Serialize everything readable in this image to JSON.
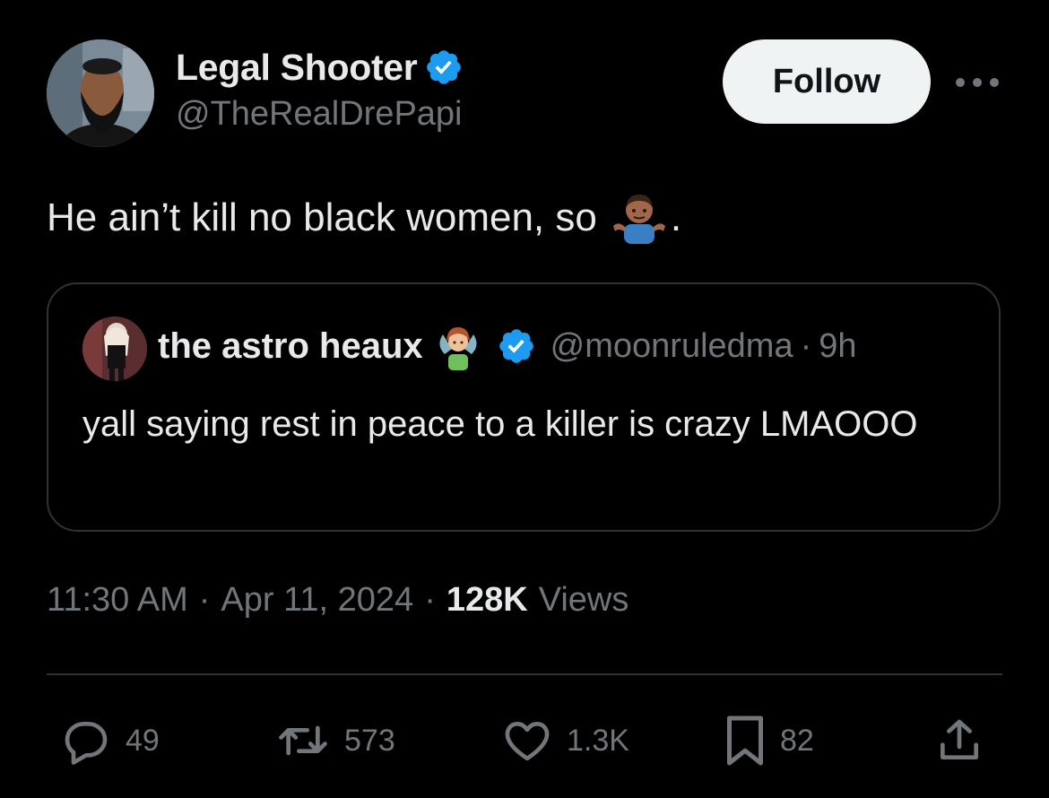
{
  "author": {
    "display_name": "Legal Shooter",
    "handle": "@TheRealDrePapi",
    "verified": true
  },
  "follow_button": {
    "label": "Follow"
  },
  "tweet": {
    "text": "He ain’t kill no black women, so",
    "emoji": "person-shrugging-emoji",
    "text_suffix": "."
  },
  "quoted_tweet": {
    "display_name": "the astro heaux",
    "name_emoji": "fairy-emoji",
    "verified": true,
    "handle": "@moonruledma",
    "separator": "·",
    "time": "9h",
    "text": "yall saying rest in peace to a killer is crazy LMAOOO"
  },
  "meta": {
    "time": "11:30 AM",
    "separator": "·",
    "date": "Apr 11, 2024",
    "views_count": "128K",
    "views_label": "Views"
  },
  "actions": {
    "replies": "49",
    "reposts": "573",
    "likes": "1.3K",
    "bookmarks": "82"
  },
  "colors": {
    "background": "#000000",
    "text_primary": "#e7e9ea",
    "text_secondary": "#71767b",
    "verified_blue": "#1d9bf0",
    "border": "#2f3336",
    "follow_bg": "#eff3f4"
  }
}
